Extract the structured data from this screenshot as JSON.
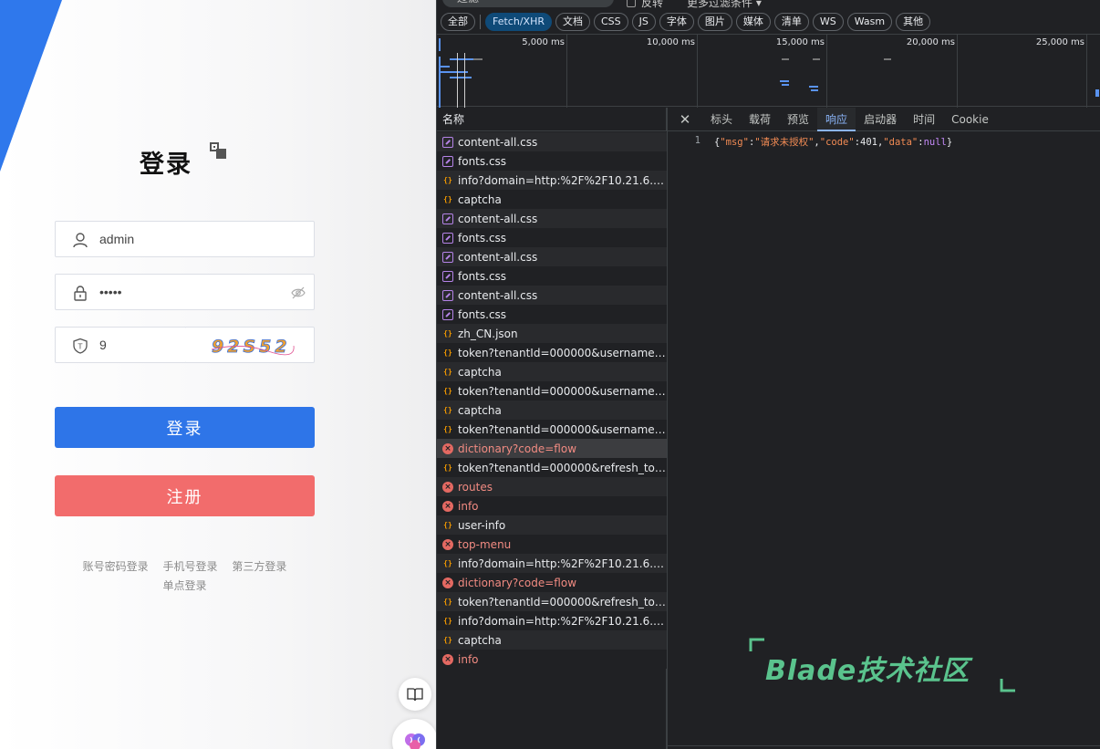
{
  "login": {
    "title": "登录",
    "username_value": "admin",
    "password_value": "•••••",
    "captcha_value": "9",
    "captcha_image_text": "92S52",
    "login_button": "登录",
    "register_button": "注册",
    "links": [
      "账号密码登录",
      "手机号登录",
      "第三方登录",
      "单点登录"
    ],
    "accent": "#2e75e8",
    "register_color": "#f26c6c"
  },
  "devtools": {
    "filter_placeholder": "过滤",
    "invert_label": "反转",
    "more_filters": "更多过滤条件",
    "type_filters": [
      "全部",
      "Fetch/XHR",
      "文档",
      "CSS",
      "JS",
      "字体",
      "图片",
      "媒体",
      "清单",
      "WS",
      "Wasm",
      "其他"
    ],
    "selected_filter": "Fetch/XHR",
    "timeline_ticks": [
      "5,000 ms",
      "10,000 ms",
      "15,000 ms",
      "20,000 ms",
      "25,000 ms"
    ],
    "name_column": "名称",
    "requests": [
      {
        "name": "content-all.css",
        "type": "css",
        "status": "ok"
      },
      {
        "name": "fonts.css",
        "type": "css",
        "status": "ok"
      },
      {
        "name": "info?domain=http:%2F%2F10.21.6.16...",
        "type": "json",
        "status": "ok"
      },
      {
        "name": "captcha",
        "type": "json",
        "status": "ok"
      },
      {
        "name": "content-all.css",
        "type": "css",
        "status": "ok"
      },
      {
        "name": "fonts.css",
        "type": "css",
        "status": "ok"
      },
      {
        "name": "content-all.css",
        "type": "css",
        "status": "ok"
      },
      {
        "name": "fonts.css",
        "type": "css",
        "status": "ok"
      },
      {
        "name": "content-all.css",
        "type": "css",
        "status": "ok"
      },
      {
        "name": "fonts.css",
        "type": "css",
        "status": "ok"
      },
      {
        "name": "zh_CN.json",
        "type": "json",
        "status": "ok"
      },
      {
        "name": "token?tenantId=000000&username=...",
        "type": "json",
        "status": "ok"
      },
      {
        "name": "captcha",
        "type": "json",
        "status": "ok"
      },
      {
        "name": "token?tenantId=000000&username=...",
        "type": "json",
        "status": "ok"
      },
      {
        "name": "captcha",
        "type": "json",
        "status": "ok"
      },
      {
        "name": "token?tenantId=000000&username=...",
        "type": "json",
        "status": "ok"
      },
      {
        "name": "dictionary?code=flow",
        "type": "err",
        "status": "error",
        "selected": true
      },
      {
        "name": "token?tenantId=000000&refresh_tok...",
        "type": "json",
        "status": "ok"
      },
      {
        "name": "routes",
        "type": "err",
        "status": "error"
      },
      {
        "name": "info",
        "type": "err",
        "status": "error"
      },
      {
        "name": "user-info",
        "type": "json",
        "status": "ok"
      },
      {
        "name": "top-menu",
        "type": "err",
        "status": "error"
      },
      {
        "name": "info?domain=http:%2F%2F10.21.6.16...",
        "type": "json",
        "status": "ok"
      },
      {
        "name": "dictionary?code=flow",
        "type": "err",
        "status": "error"
      },
      {
        "name": "token?tenantId=000000&refresh_tok...",
        "type": "json",
        "status": "ok"
      },
      {
        "name": "info?domain=http:%2F%2F10.21.6.16...",
        "type": "json",
        "status": "ok"
      },
      {
        "name": "captcha",
        "type": "json",
        "status": "ok"
      },
      {
        "name": "info",
        "type": "err",
        "status": "error"
      }
    ],
    "detail_tabs": [
      "标头",
      "载荷",
      "预览",
      "响应",
      "启动器",
      "时间",
      "Cookie"
    ],
    "active_tab": "响应",
    "response": {
      "line_number": "1",
      "msg_key": "\"msg\"",
      "msg_value": "\"请求未授权\"",
      "code_key": "\"code\"",
      "code_value": "401",
      "data_key": "\"data\"",
      "data_value": "null"
    },
    "watermark": "Blade技术社区"
  }
}
